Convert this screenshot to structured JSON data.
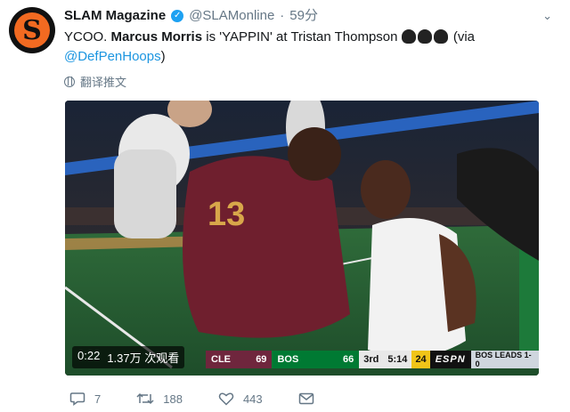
{
  "account": {
    "display_name": "SLAM Magazine",
    "handle": "@SLAMonline",
    "separator": "·",
    "time": "59分",
    "avatar_letter": "S"
  },
  "tweet": {
    "text_1": "YCOO. ",
    "text_bold": "Marcus Morris",
    "text_2": " is 'YAPPIN' at Tristan Thompson ",
    "text_3": " (via ",
    "mention": "@DefPenHoops",
    "text_4": ")",
    "translate_label": "翻译推文"
  },
  "video": {
    "duration": "0:22",
    "views": "1.37万 次观看",
    "scorebug": {
      "away_abbr": "CLE",
      "away_score": "69",
      "home_abbr": "BOS",
      "home_score": "66",
      "quarter": "3rd",
      "clock": "5:14",
      "shot_clock": "24",
      "network": "ESPN",
      "series": "BOS LEADS 1-0"
    }
  },
  "actions": {
    "replies": "7",
    "retweets": "188",
    "likes": "443"
  },
  "colors": {
    "link": "#1b95e0",
    "verified": "#1da1f2",
    "muted": "#657786",
    "cle": "#6f263d",
    "bos": "#007a33"
  }
}
